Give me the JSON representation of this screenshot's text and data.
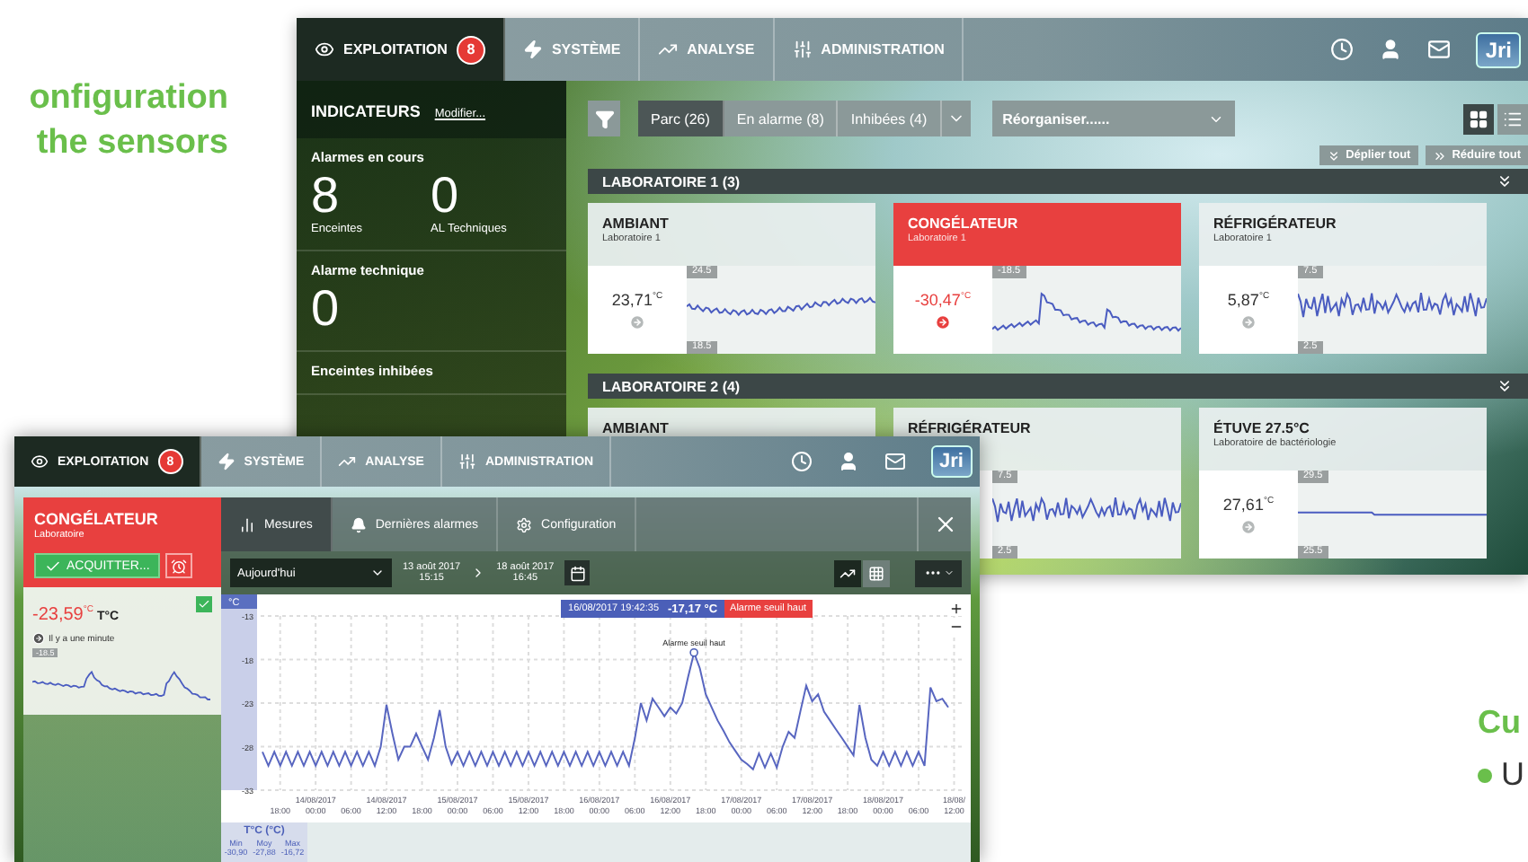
{
  "headline": [
    "onfiguration",
    "the sensors"
  ],
  "back_window": {
    "nav": {
      "tabs": [
        {
          "label": "EXPLOITATION",
          "kind": "eye",
          "badge": "8",
          "selected": true
        },
        {
          "label": "SYSTÈME",
          "kind": "bolt",
          "selected": false
        },
        {
          "label": "ANALYSE",
          "kind": "trend",
          "selected": false
        },
        {
          "label": "ADMINISTRATION",
          "kind": "sliders",
          "selected": false
        }
      ],
      "logo": "Jri"
    },
    "sidebar": {
      "title": "INDICATEURS",
      "link": "Modifier...",
      "sections": [
        {
          "label": "Alarmes en cours",
          "stats": [
            {
              "value": "8",
              "caption": "Enceintes"
            },
            {
              "value": "0",
              "caption": "AL Techniques"
            }
          ]
        },
        {
          "label": "Alarme technique",
          "stats": [
            {
              "value": "0"
            }
          ]
        },
        {
          "label": "Enceintes inhibées"
        }
      ]
    },
    "filters": [
      {
        "label": "Parc (26)",
        "selected": true
      },
      {
        "label": "En alarme (8)",
        "selected": false
      },
      {
        "label": "Inhibées (4)",
        "selected": false
      }
    ],
    "reorganize": "Réorganiser......",
    "views": [
      {
        "kind": "grid",
        "selected": true
      },
      {
        "kind": "list",
        "selected": false
      }
    ],
    "actions": [
      {
        "label": "Déplier tout",
        "kind": "expand"
      },
      {
        "label": "Réduire tout",
        "kind": "collapse"
      }
    ],
    "groups": [
      {
        "title": "LABORATOIRE 1 (3)",
        "sensors": [
          {
            "title": "AMBIANT",
            "subtitle": "Laboratoire 1",
            "value": "23,71",
            "unit": "°C",
            "alarm": false,
            "range_high": "24.5",
            "range_low": "18.5",
            "kind": "flat"
          },
          {
            "title": "CONGÉLATEUR",
            "subtitle": "Laboratoire 1",
            "value": "-30,47",
            "unit": "°C",
            "alarm": true,
            "range_high": "-18.5",
            "kind": "peaks"
          },
          {
            "title": "RÉFRIGÉRATEUR",
            "subtitle": "Laboratoire 1",
            "value": "5,87",
            "unit": "°C",
            "alarm": false,
            "range_high": "7.5",
            "range_low": "2.5",
            "kind": "noisy"
          }
        ]
      },
      {
        "title": "LABORATOIRE 2 (4)",
        "sensors": [
          {
            "title": "AMBIANT",
            "alarm": false,
            "kind": "hidden"
          },
          {
            "title": "RÉFRIGÉRATEUR",
            "alarm": false,
            "range_high": "7.5",
            "range_low": "2.5",
            "kind": "noisy"
          },
          {
            "title": "ÉTUVE 27.5°C",
            "subtitle": "Laboratoire de bactériologie",
            "value": "27,61",
            "unit": "°C",
            "alarm": false,
            "range_high": "29.5",
            "range_low": "25.5",
            "kind": "steady"
          }
        ]
      }
    ]
  },
  "front_window": {
    "nav": {
      "tabs": [
        {
          "label": "EXPLOITATION",
          "kind": "eye",
          "badge": "8",
          "selected": true
        },
        {
          "label": "SYSTÈME",
          "kind": "bolt",
          "selected": false
        },
        {
          "label": "ANALYSE",
          "kind": "trend",
          "selected": false
        },
        {
          "label": "ADMINISTRATION",
          "kind": "sliders",
          "selected": false
        }
      ],
      "logo": "Jri"
    },
    "sensor": {
      "title": "CONGÉLATEUR",
      "subtitle": "Laboratoire",
      "alarm": true,
      "acknowledge": "ACQUITTER...",
      "value": "-23,59",
      "unit": "°C",
      "channel": "T°C",
      "checked": true,
      "age": "Il y a une minute",
      "range": "-18.5",
      "kind": "wave"
    },
    "tabs": [
      {
        "label": "Mesures",
        "kind": "bars",
        "selected": true
      },
      {
        "label": "Dernières alarmes",
        "kind": "bell",
        "selected": false
      },
      {
        "label": "Configuration",
        "kind": "gear",
        "selected": false
      }
    ],
    "period": "Aujourd'hui",
    "from": {
      "date": "13 août 2017",
      "time": "15:15"
    },
    "to": {
      "date": "18 août 2017",
      "time": "16:45"
    },
    "modes": [
      {
        "kind": "line",
        "selected": true
      },
      {
        "kind": "table",
        "selected": false
      }
    ],
    "chart_data": {
      "type": "line",
      "grid": true,
      "ylabel": "°C",
      "ylim": [
        -33,
        -13
      ],
      "yticks": [
        -13,
        -18,
        -23,
        -28,
        -33
      ],
      "categories": [
        null,
        null,
        null,
        "18:00",
        null,
        null,
        null,
        null,
        null,
        "14/08/2017 00:00",
        null,
        null,
        null,
        null,
        null,
        "06:00",
        null,
        null,
        null,
        null,
        null,
        "14/08/2017 12:00",
        null,
        null,
        null,
        null,
        null,
        "18:00",
        null,
        null,
        null,
        null,
        null,
        "15/08/2017 00:00",
        null,
        null,
        null,
        null,
        null,
        "06:00",
        null,
        null,
        null,
        null,
        null,
        "15/08/2017 12:00",
        null,
        null,
        null,
        null,
        null,
        "18:00",
        null,
        null,
        null,
        null,
        null,
        "16/08/2017 00:00",
        null,
        null,
        null,
        null,
        null,
        "06:00",
        null,
        null,
        null,
        null,
        null,
        "16/08/2017 12:00",
        null,
        null,
        null,
        null,
        null,
        "18:00",
        null,
        null,
        null,
        null,
        null,
        "17/08/2017 00:00",
        null,
        null,
        null,
        null,
        null,
        "06:00",
        null,
        null,
        null,
        null,
        null,
        "17/08/2017 12:00",
        null,
        null,
        null,
        null,
        null,
        "18:00",
        null,
        null,
        null,
        null,
        null,
        "18/08/2017 00:00",
        null,
        null,
        null,
        null,
        null,
        "06:00",
        null,
        null,
        null,
        null,
        null,
        "18/08/ 12:00"
      ],
      "series": [
        {
          "color": "#5866c0",
          "values": [
            -28.6,
            -30.2,
            -28.6,
            -30.2,
            -28.6,
            -30.2,
            -28.6,
            -30.2,
            -28.6,
            -30.2,
            -28.6,
            -30.2,
            -28.6,
            -30.2,
            -28.6,
            -30.2,
            -28.6,
            -30.2,
            -28.6,
            -30.2,
            -28,
            -23.2,
            -26.5,
            -29.5,
            -28,
            -28,
            -26.5,
            -28,
            -29.5,
            -27,
            -23.8,
            -28,
            -30,
            -28.6,
            -30.2,
            -28.6,
            -30.2,
            -28.6,
            -30.2,
            -28.6,
            -30.2,
            -28.6,
            -30.2,
            -28.6,
            -30.2,
            -28.6,
            -30.2,
            -28.6,
            -30.2,
            -28.6,
            -30.2,
            -28.6,
            -30.2,
            -28.6,
            -30.2,
            -28.6,
            -30.2,
            -28.6,
            -30.2,
            -28.6,
            -30.2,
            -28.6,
            -30.2,
            -27,
            -23,
            -25,
            -22.5,
            -23.5,
            -24.5,
            -23.5,
            -24.2,
            -23,
            -20,
            -17.2,
            -19,
            -22,
            -23.5,
            -25,
            -26.2,
            -27.5,
            -28.5,
            -29.5,
            -30,
            -30.6,
            -28.8,
            -30.4,
            -28.8,
            -30.4,
            -28,
            -26.3,
            -27,
            -24,
            -21,
            -22.8,
            -22,
            -24,
            -25,
            -26,
            -27,
            -28,
            -29,
            -23.2,
            -27,
            -29.5,
            -30.2,
            -28.6,
            -30.2,
            -28.6,
            -30.2,
            -28.6,
            -30.2,
            -28.6,
            -30.2,
            -21.2,
            -22.8,
            -22.5,
            -23.5,
            null
          ]
        }
      ],
      "annotations": [
        {
          "y": -17.2,
          "text": "Alarme seuil haut"
        }
      ]
    },
    "tooltip": {
      "time": "16/08/2017 19:42:35",
      "value": "-17,17 °C",
      "alarm": "Alarme seuil haut"
    },
    "legend": {
      "title": "T°C (°C)",
      "stats": [
        {
          "label": "Min",
          "value": "-30,90"
        },
        {
          "label": "Moy",
          "value": "-27,88"
        },
        {
          "label": "Max",
          "value": "-16,72"
        }
      ]
    }
  },
  "side_text": {
    "heading": "Cu",
    "bullets": [
      "U"
    ]
  }
}
